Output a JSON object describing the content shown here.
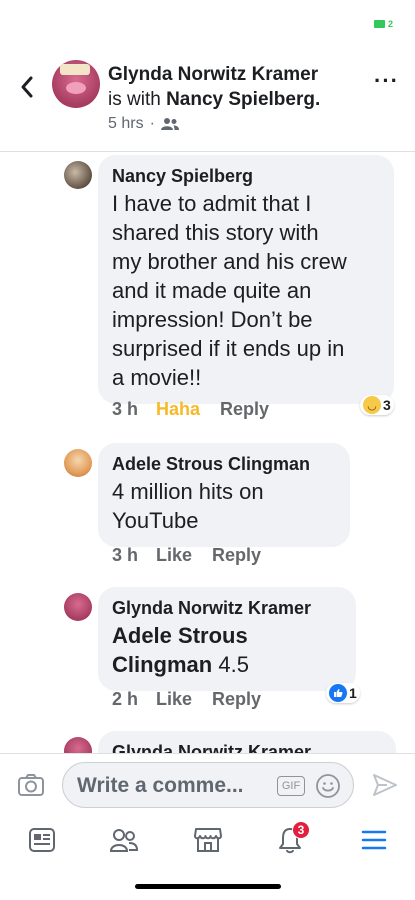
{
  "status_bar": {
    "battery_level": "2",
    "battery_color": "#34c759"
  },
  "header": {
    "author": "Glynda Norwitz Kramer",
    "with_text": "is with",
    "tagged": "Nancy Spielberg.",
    "time": "5 hrs",
    "separator": "·",
    "audience_icon": "friends-icon",
    "back_icon": "chevron-left-icon",
    "more_label": "···"
  },
  "comments": [
    {
      "author": "Nancy Spielberg",
      "lines": [
        "I have to admit that I",
        "shared this story with",
        "my brother and his crew",
        "and it made quite an",
        "impression! Don’t be",
        "surprised if it ends up in",
        "a movie!!"
      ],
      "time": "3 h",
      "reaction_label": "Haha",
      "reply_label": "Reply",
      "reaction_count": "3",
      "reaction_icon": "haha-emoji-icon"
    },
    {
      "author": "Adele Strous Clingman",
      "lines": [
        "4 million hits on",
        "YouTube"
      ],
      "time": "3 h",
      "like_label": "Like",
      "reply_label": "Reply"
    },
    {
      "author": "Glynda Norwitz Kramer",
      "mention_line1": "Adele Strous",
      "mention_line2": "Clingman",
      "after_mention": " 4.5",
      "time": "2 h",
      "like_label": "Like",
      "reply_label": "Reply",
      "reaction_count": "1",
      "reaction_icon": "like-thumb-icon"
    },
    {
      "author": "Glynda Norwitz Kramer"
    }
  ],
  "composer": {
    "placeholder": "Write a comme...",
    "gif_label": "GIF",
    "camera_icon": "camera-icon",
    "emoji_icon": "smiley-icon",
    "send_icon": "send-icon"
  },
  "bottom_nav": {
    "items": [
      "news-feed-icon",
      "friends-icon",
      "marketplace-icon",
      "notifications-icon",
      "menu-icon"
    ],
    "notification_badge": "3",
    "active_color": "#1877f2"
  }
}
